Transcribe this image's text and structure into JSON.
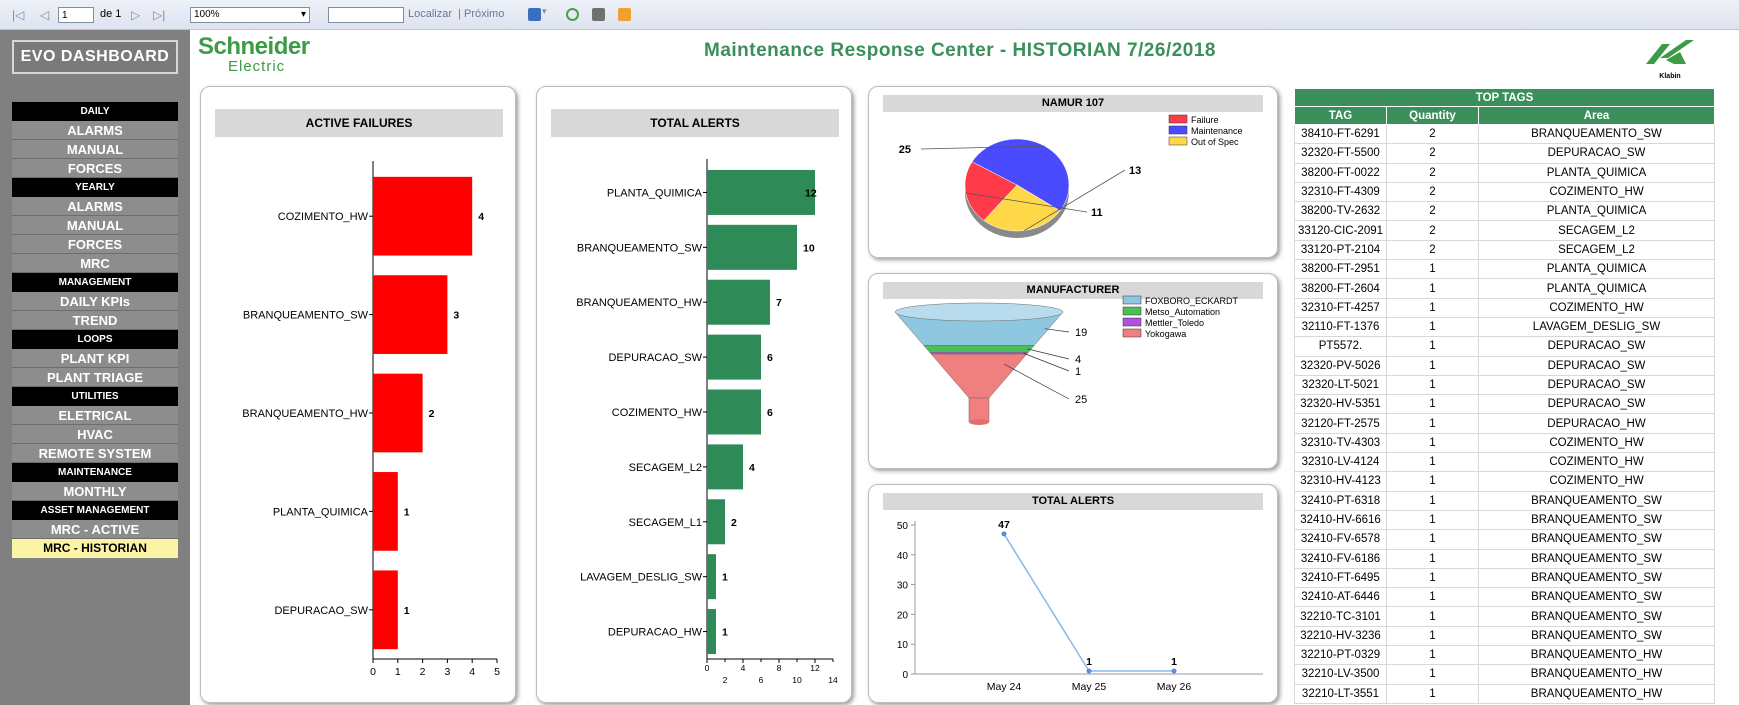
{
  "toolbar": {
    "first_icon": "first-page-icon",
    "page_value": "1",
    "page_of": "de 1",
    "zoom_value": "100%",
    "find_placeholder": "",
    "find_label": "Localizar",
    "separator": "|",
    "next_label": "Próximo"
  },
  "sidebar": {
    "title": "EVO DASHBOARD",
    "items": [
      {
        "label": "DAILY",
        "kind": "hdr"
      },
      {
        "label": "ALARMS",
        "kind": "btn"
      },
      {
        "label": "MANUAL",
        "kind": "btn"
      },
      {
        "label": "FORCES",
        "kind": "btn"
      },
      {
        "label": "YEARLY",
        "kind": "hdr"
      },
      {
        "label": "ALARMS",
        "kind": "btn"
      },
      {
        "label": "MANUAL",
        "kind": "btn"
      },
      {
        "label": "FORCES",
        "kind": "btn"
      },
      {
        "label": "MRC",
        "kind": "btn"
      },
      {
        "label": "MANAGEMENT",
        "kind": "hdr"
      },
      {
        "label": "DAILY KPIs",
        "kind": "btn"
      },
      {
        "label": "TREND",
        "kind": "btn"
      },
      {
        "label": "LOOPS",
        "kind": "hdr"
      },
      {
        "label": "PLANT KPI",
        "kind": "btn"
      },
      {
        "label": "PLANT TRIAGE",
        "kind": "btn"
      },
      {
        "label": "UTILITIES",
        "kind": "hdr"
      },
      {
        "label": "ELETRICAL",
        "kind": "btn"
      },
      {
        "label": "HVAC",
        "kind": "btn"
      },
      {
        "label": "REMOTE SYSTEM",
        "kind": "btn"
      },
      {
        "label": "MAINTENANCE",
        "kind": "hdr"
      },
      {
        "label": "MONTHLY",
        "kind": "btn"
      },
      {
        "label": "ASSET MANAGEMENT",
        "kind": "hdr"
      },
      {
        "label": "MRC - ACTIVE",
        "kind": "btn"
      },
      {
        "label": "MRC - HISTORIAN",
        "kind": "active"
      }
    ]
  },
  "header": {
    "brand_line1": "Schneider",
    "brand_line2": "Electric",
    "title": "Maintenance Response Center - HISTORIAN 7/26/2018",
    "klabin_label": "Klabin"
  },
  "colors": {
    "red_bar": "#ff0000",
    "green_bar": "#2e8b57",
    "header_green": "#3b8f5a",
    "failure": "#ff3b4a",
    "maintenance": "#4a4aff",
    "out_of_spec": "#ffd84a",
    "foxboro": "#8ec8e0",
    "metso": "#4bbf5a",
    "mettler": "#b44fe0",
    "yokogawa": "#f08080"
  },
  "chart_data": [
    {
      "type": "bar",
      "orientation": "horizontal",
      "title": "ACTIVE FAILURES",
      "categories": [
        "COZIMENTO_HW",
        "BRANQUEAMENTO_SW",
        "BRANQUEAMENTO_HW",
        "PLANTA_QUIMICA",
        "DEPURACAO_SW"
      ],
      "values": [
        4,
        3,
        2,
        1,
        1
      ],
      "xlim": [
        0,
        5
      ],
      "xticks": [
        "0",
        "1",
        "2",
        "3",
        "4",
        "5"
      ]
    },
    {
      "type": "bar",
      "orientation": "horizontal",
      "title": "TOTAL ALERTS",
      "categories": [
        "PLANTA_QUIMICA",
        "BRANQUEAMENTO_SW",
        "BRANQUEAMENTO_HW",
        "DEPURACAO_SW",
        "COZIMENTO_HW",
        "SECAGEM_L2",
        "SECAGEM_L1",
        "LAVAGEM_DESLIG_SW",
        "DEPURACAO_HW"
      ],
      "values": [
        12,
        10,
        7,
        6,
        6,
        4,
        2,
        1,
        1
      ],
      "xlim": [
        0,
        14
      ],
      "xticks_top": [
        "0",
        "4",
        "8",
        "12"
      ],
      "xticks_bottom": [
        "2",
        "6",
        "10",
        "14"
      ]
    },
    {
      "type": "pie",
      "title": "NAMUR 107",
      "labels": [
        "Failure",
        "Maintenance",
        "Out of Spec"
      ],
      "values": [
        11,
        25,
        13
      ],
      "legend": "top-right"
    },
    {
      "type": "funnel",
      "title": "MANUFACTURER",
      "labels": [
        "FOXBORO_ECKARDT",
        "Metso_Automation",
        "Mettler_Toledo",
        "Yokogawa"
      ],
      "values": [
        19,
        4,
        1,
        25
      ],
      "legend": "top-right"
    },
    {
      "type": "line",
      "title": "TOTAL ALERTS",
      "categories": [
        "May 24",
        "May 25",
        "May 26"
      ],
      "values": [
        47,
        1,
        1
      ],
      "ylim": [
        0,
        50
      ],
      "yticks": [
        "0",
        "10",
        "20",
        "30",
        "40",
        "50"
      ]
    }
  ],
  "top_tags": {
    "title": "TOP TAGS",
    "columns": [
      "TAG",
      "Quantity",
      "Area"
    ],
    "rows": [
      [
        "38410-FT-6291",
        "2",
        "BRANQUEAMENTO_SW"
      ],
      [
        "32320-FT-5500",
        "2",
        "DEPURACAO_SW"
      ],
      [
        "38200-FT-0022",
        "2",
        "PLANTA_QUIMICA"
      ],
      [
        "32310-FT-4309",
        "2",
        "COZIMENTO_HW"
      ],
      [
        "38200-TV-2632",
        "2",
        "PLANTA_QUIMICA"
      ],
      [
        "33120-CIC-2091",
        "2",
        "SECAGEM_L2"
      ],
      [
        "33120-PT-2104",
        "2",
        "SECAGEM_L2"
      ],
      [
        "38200-FT-2951",
        "1",
        "PLANTA_QUIMICA"
      ],
      [
        "38200-FT-2604",
        "1",
        "PLANTA_QUIMICA"
      ],
      [
        "32310-FT-4257",
        "1",
        "COZIMENTO_HW"
      ],
      [
        "32110-FT-1376",
        "1",
        "LAVAGEM_DESLIG_SW"
      ],
      [
        "PT5572.",
        "1",
        "DEPURACAO_SW"
      ],
      [
        "32320-PV-5026",
        "1",
        "DEPURACAO_SW"
      ],
      [
        "32320-LT-5021",
        "1",
        "DEPURACAO_SW"
      ],
      [
        "32320-HV-5351",
        "1",
        "DEPURACAO_SW"
      ],
      [
        "32120-FT-2575",
        "1",
        "DEPURACAO_HW"
      ],
      [
        "32310-TV-4303",
        "1",
        "COZIMENTO_HW"
      ],
      [
        "32310-LV-4124",
        "1",
        "COZIMENTO_HW"
      ],
      [
        "32310-HV-4123",
        "1",
        "COZIMENTO_HW"
      ],
      [
        "32410-PT-6318",
        "1",
        "BRANQUEAMENTO_SW"
      ],
      [
        "32410-HV-6616",
        "1",
        "BRANQUEAMENTO_SW"
      ],
      [
        "32410-FV-6578",
        "1",
        "BRANQUEAMENTO_SW"
      ],
      [
        "32410-FV-6186",
        "1",
        "BRANQUEAMENTO_SW"
      ],
      [
        "32410-FT-6495",
        "1",
        "BRANQUEAMENTO_SW"
      ],
      [
        "32410-AT-6446",
        "1",
        "BRANQUEAMENTO_SW"
      ],
      [
        "32210-TC-3101",
        "1",
        "BRANQUEAMENTO_SW"
      ],
      [
        "32210-HV-3236",
        "1",
        "BRANQUEAMENTO_SW"
      ],
      [
        "32210-PT-0329",
        "1",
        "BRANQUEAMENTO_HW"
      ],
      [
        "32210-LV-3500",
        "1",
        "BRANQUEAMENTO_HW"
      ],
      [
        "32210-LT-3551",
        "1",
        "BRANQUEAMENTO_HW"
      ]
    ]
  }
}
